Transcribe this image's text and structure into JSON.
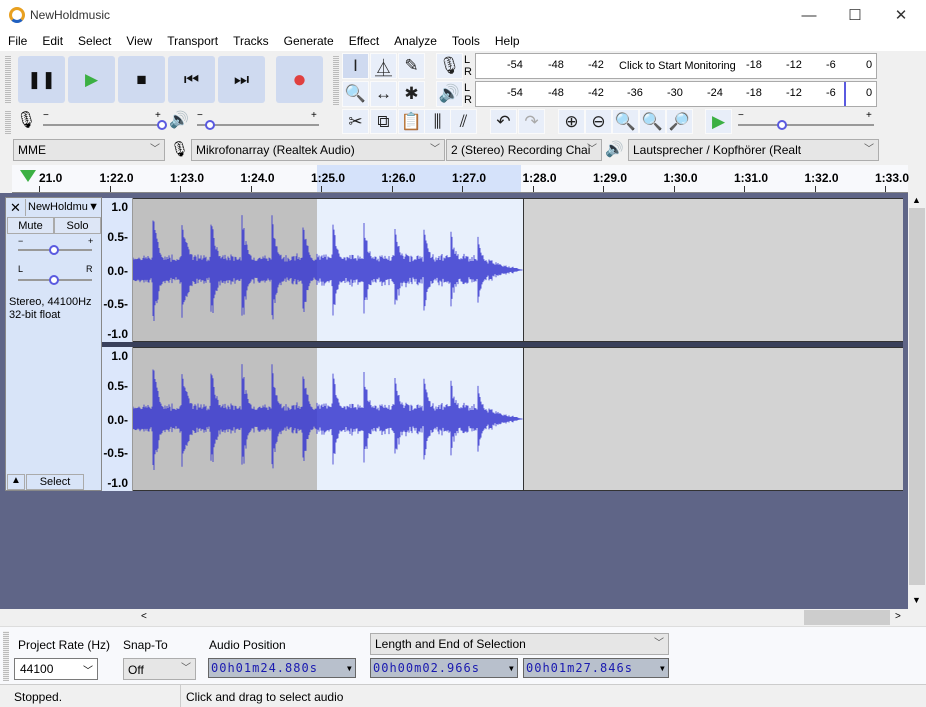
{
  "window": {
    "title": "NewHoldmusic",
    "minimize": "—",
    "maximize": "☐",
    "close": "✕"
  },
  "menu": [
    "File",
    "Edit",
    "Select",
    "View",
    "Transport",
    "Tracks",
    "Generate",
    "Effect",
    "Analyze",
    "Tools",
    "Help"
  ],
  "transport": {
    "icons": [
      "pause-icon",
      "play-icon",
      "stop-icon",
      "skip-to-start-icon",
      "skip-to-end-icon",
      "record-icon"
    ],
    "play_color": "#3cb043",
    "record_color": "#e04040"
  },
  "tools": [
    "selection-tool",
    "envelope-tool",
    "draw-tool",
    "zoom-tool",
    "timeshift-tool",
    "multi-tool"
  ],
  "meters": {
    "record_ticks": [
      "-54",
      "-48",
      "-42",
      "-18",
      "-12",
      "-6",
      "0"
    ],
    "record_prompt": "Click to Start Monitoring",
    "playback_ticks": [
      "-54",
      "-48",
      "-42",
      "-36",
      "-30",
      "-24",
      "-18",
      "-12",
      "-6",
      "0"
    ],
    "L": "L",
    "R": "R"
  },
  "mixer": {
    "minus": "−",
    "plus": "+",
    "rec_volume": 1.0,
    "play_volume": 0.05,
    "speed": 0.5
  },
  "devices": {
    "host": "MME",
    "input": "Mikrofonarray (Realtek Audio)",
    "channels": "2 (Stereo) Recording Chai",
    "output": "Lautsprecher / Kopfhörer (Realt"
  },
  "ruler": {
    "ticks": [
      "21.0",
      "1:22.0",
      "1:23.0",
      "1:24.0",
      "1:25.0",
      "1:26.0",
      "1:27.0",
      "1:28.0",
      "1:29.0",
      "1:30.0",
      "1:31.0",
      "1:32.0",
      "1:33.0"
    ]
  },
  "track": {
    "name": "NewHoldmu",
    "mute": "Mute",
    "solo": "Solo",
    "gain_minus": "−",
    "gain_plus": "+",
    "pan_l": "L",
    "pan_r": "R",
    "info1": "Stereo, 44100Hz",
    "info2": "32-bit float",
    "select": "Select",
    "scale": [
      "1.0",
      "0.5-",
      "0.0-",
      "-0.5-",
      "-1.0"
    ],
    "wave_color": "#3a3ad0"
  },
  "selectionbar": {
    "rate_label": "Project Rate (Hz)",
    "rate": "44100",
    "snap_label": "Snap-To",
    "snap": "Off",
    "pos_label": "Audio Position",
    "position": "00h01m24.880s",
    "sel_mode": "Length and End of Selection",
    "length": "00h00m02.966s",
    "end": "00h01m27.846s"
  },
  "status": {
    "state": "Stopped.",
    "hint": "Click and drag to select audio"
  }
}
